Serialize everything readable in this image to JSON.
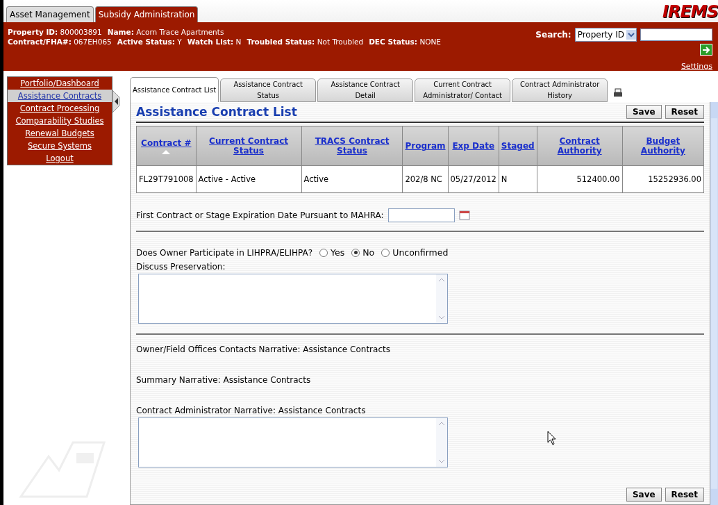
{
  "app_tabs": [
    {
      "label": "Asset Management",
      "selected": false
    },
    {
      "label": "Subsidy Administration",
      "selected": true
    }
  ],
  "logo": "IREMS",
  "header": {
    "lines": [
      [
        {
          "label": "Property ID:",
          "value": "800003891"
        },
        {
          "label": "Name:",
          "value": "Acorn Trace Apartments"
        }
      ],
      [
        {
          "label": "Contract/FHA#:",
          "value": "067EH065"
        },
        {
          "label": "Active Status:",
          "value": "Y"
        },
        {
          "label": "Watch List:",
          "value": "N"
        },
        {
          "label": "Troubled Status:",
          "value": "Not Troubled"
        },
        {
          "label": "DEC Status:",
          "value": "NONE"
        }
      ]
    ],
    "search_label": "Search:",
    "search_type": "Property ID",
    "settings": "Settings"
  },
  "sidebar": {
    "items": [
      {
        "label": "Portfolio/Dashboard",
        "selected": false
      },
      {
        "label": "Assistance Contracts",
        "selected": true
      },
      {
        "label": "Contract Processing",
        "selected": false
      },
      {
        "label": "Comparability Studies",
        "selected": false
      },
      {
        "label": "Renewal Budgets",
        "selected": false
      },
      {
        "label": "Secure Systems",
        "selected": false
      },
      {
        "label": "Logout",
        "selected": false
      }
    ]
  },
  "tabs": [
    {
      "label": "Assistance Contract List",
      "selected": true
    },
    {
      "label": "Assistance Contract Status",
      "selected": false
    },
    {
      "label": "Assistance Contract Detail",
      "selected": false
    },
    {
      "label": "Current Contract Administrator/ Contact",
      "selected": false
    },
    {
      "label": "Contract Administrator History",
      "selected": false
    }
  ],
  "title": "Assistance Contract List",
  "buttons": [
    "Save",
    "Reset"
  ],
  "table": {
    "columns": [
      {
        "label": "Contract #",
        "sorted": true
      },
      {
        "label": "Current Contract Status",
        "sorted": false
      },
      {
        "label": "TRACS Contract Status",
        "sorted": false
      },
      {
        "label": "Program",
        "sorted": false
      },
      {
        "label": "Exp Date",
        "sorted": false
      },
      {
        "label": "Staged",
        "sorted": false
      },
      {
        "label": "Contract Authority",
        "sorted": false
      },
      {
        "label": "Budget Authority",
        "sorted": false
      }
    ],
    "rows": [
      [
        "FL29T791008",
        "Active - Active",
        "Active",
        "202/8 NC",
        "05/27/2012",
        "N",
        "512400.00",
        "15252936.00"
      ]
    ]
  },
  "mahra_label": "First Contract or Stage Expiration Date Pursuant to MAHRA:",
  "lihpra": {
    "label": "Does Owner Participate in LIHPRA/ELIHPA?",
    "options": [
      {
        "label": "Yes",
        "selected": false
      },
      {
        "label": "No",
        "selected": true
      },
      {
        "label": "Unconfirmed",
        "selected": false
      }
    ]
  },
  "discuss_label": "Discuss Preservation:",
  "narratives": [
    "Owner/Field Offices Contacts Narrative: Assistance Contracts",
    "Summary Narrative: Assistance Contracts"
  ],
  "ca_narrative_label": "Contract Administrator Narrative: Assistance Contracts",
  "bottom_buttons": [
    "Save",
    "Reset"
  ]
}
